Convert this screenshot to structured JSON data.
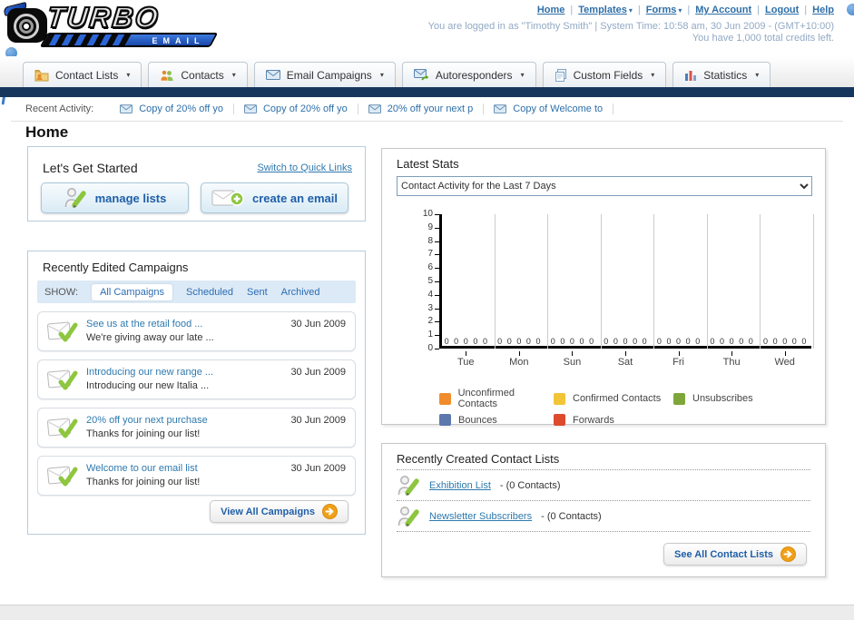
{
  "logo": {
    "title": "TURBO",
    "subtitle": "EMAIL"
  },
  "topnav": {
    "links": [
      {
        "label": "Home",
        "dropdown": false
      },
      {
        "label": "Templates",
        "dropdown": true
      },
      {
        "label": "Forms",
        "dropdown": true
      },
      {
        "label": "My Account",
        "dropdown": false
      },
      {
        "label": "Logout",
        "dropdown": false
      },
      {
        "label": "Help",
        "dropdown": false
      }
    ]
  },
  "session": {
    "login_line": "You are logged in as \"Timothy Smith\" | System Time: 10:58 am, 30 Jun 2009 - (GMT+10:00)",
    "credits_line": "You have 1,000 total credits left."
  },
  "mainnav": {
    "tabs": [
      {
        "label": "Contact Lists",
        "icon": "folder-user-icon"
      },
      {
        "label": "Contacts",
        "icon": "contacts-icon"
      },
      {
        "label": "Email Campaigns",
        "icon": "envelope-icon"
      },
      {
        "label": "Autoresponders",
        "icon": "envelope-arrow-icon"
      },
      {
        "label": "Custom Fields",
        "icon": "pages-icon"
      },
      {
        "label": "Statistics",
        "icon": "bar-chart-icon"
      }
    ]
  },
  "recent_activity": {
    "label": "Recent Activity:",
    "items": [
      "Copy of 20% off yo",
      "Copy of 20% off yo",
      "20% off your next p",
      "Copy of Welcome to"
    ]
  },
  "page_title": "Home",
  "get_started": {
    "title": "Let's Get Started",
    "switch_link": "Switch to Quick Links",
    "buttons": [
      {
        "label": "manage lists",
        "icon": "person-pencil-icon"
      },
      {
        "label": "create an email",
        "icon": "envelope-plus-icon"
      }
    ]
  },
  "campaigns": {
    "title": "Recently Edited Campaigns",
    "show_label": "SHOW:",
    "tabs": [
      {
        "label": "All Campaigns",
        "active": true
      },
      {
        "label": "Scheduled",
        "active": false
      },
      {
        "label": "Sent",
        "active": false
      },
      {
        "label": "Archived",
        "active": false
      }
    ],
    "items": [
      {
        "title": "See us at the retail food ...",
        "subtitle": "We're giving away our late ...",
        "date": "30 Jun 2009"
      },
      {
        "title": "Introducing our new range ...",
        "subtitle": "Introducing our new Italia ...",
        "date": "30 Jun 2009"
      },
      {
        "title": "20% off your next purchase",
        "subtitle": "Thanks for joining our list!",
        "date": "30 Jun 2009"
      },
      {
        "title": "Welcome to our email list",
        "subtitle": "Thanks for joining our list!",
        "date": "30 Jun 2009"
      }
    ],
    "view_all_label": "View All Campaigns"
  },
  "stats": {
    "title": "Latest Stats",
    "selected_filter": "Contact Activity for the Last 7 Days"
  },
  "chart_data": {
    "type": "bar",
    "title": "Contact Activity for the Last 7 Days",
    "categories": [
      "Tue",
      "Mon",
      "Sun",
      "Sat",
      "Fri",
      "Thu",
      "Wed"
    ],
    "series": [
      {
        "name": "Unconfirmed Contacts",
        "color": "#F08C2C",
        "values": [
          0,
          0,
          0,
          0,
          0,
          0,
          0
        ]
      },
      {
        "name": "Confirmed Contacts",
        "color": "#F2C437",
        "values": [
          0,
          0,
          0,
          0,
          0,
          0,
          0
        ]
      },
      {
        "name": "Unsubscribes",
        "color": "#7EA63B",
        "values": [
          0,
          0,
          0,
          0,
          0,
          0,
          0
        ]
      },
      {
        "name": "Bounces",
        "color": "#5D78AC",
        "values": [
          0,
          0,
          0,
          0,
          0,
          0,
          0
        ]
      },
      {
        "name": "Forwards",
        "color": "#DD4B2E",
        "values": [
          0,
          0,
          0,
          0,
          0,
          0,
          0
        ]
      }
    ],
    "ylim": [
      0,
      10
    ],
    "yticks": [
      0,
      1,
      2,
      3,
      4,
      5,
      6,
      7,
      8,
      9,
      10
    ],
    "bar_value_label": "0",
    "grid": "vertical",
    "legend_position": "bottom"
  },
  "contact_lists": {
    "title": "Recently Created Contact Lists",
    "items": [
      {
        "name": "Exhibition List",
        "count": "- (0 Contacts)"
      },
      {
        "name": "Newsletter Subscribers",
        "count": "- (0 Contacts)"
      }
    ],
    "see_all_label": "See All Contact Lists"
  }
}
